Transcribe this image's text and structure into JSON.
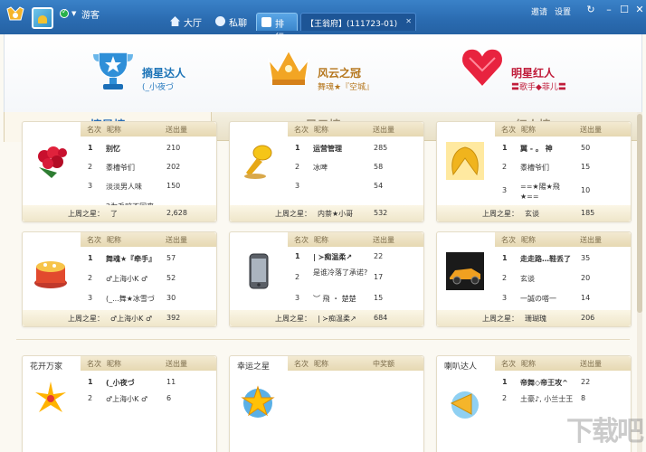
{
  "window": {
    "username": "游客",
    "nav": {
      "hall": "大厅",
      "chat": "私聊",
      "rank": "排行",
      "room": "【王翁府】(111723-01)"
    },
    "links": {
      "invite": "邀请",
      "settings": "设置"
    }
  },
  "stars": [
    {
      "title": "摘星达人",
      "who": "(_小夜づ",
      "icon": "trophy-icon"
    },
    {
      "title": "风云之冠",
      "who": "舞魂★『空城』",
      "icon": "crown-icon"
    },
    {
      "title": "明星红人",
      "who": "〓歌手◆菲儿〓",
      "icon": "heart-icon"
    }
  ],
  "rank_tabs": [
    "摘星榜",
    "风云榜",
    "红人榜"
  ],
  "columns": {
    "rank": "名次",
    "nick": "昵称",
    "amount": "送出量",
    "win": "中奖额"
  },
  "cards": [
    {
      "gift": "roses-icon",
      "rows": [
        [
          "1",
          "别忆",
          "210"
        ],
        [
          "2",
          "黍槽爷们",
          "202"
        ],
        [
          "3",
          "淡淡男人味",
          "150"
        ],
        [
          "",
          "2为毛咬不回来",
          ""
        ]
      ],
      "last_label": "上周之星：",
      "last_name": "了",
      "last_value": "2,628"
    },
    {
      "gift": "golden-microphone-icon",
      "rows": [
        [
          "1",
          "运营管理",
          "285"
        ],
        [
          "2",
          "冰啤",
          "58"
        ],
        [
          "3",
          "",
          "54"
        ]
      ],
      "last_label": "上周之星：",
      "last_name": "内萘★小哥",
      "last_value": "532"
    },
    {
      "gift": "gold-wings-icon",
      "rows": [
        [
          "1",
          "翼 -  。 神",
          "50"
        ],
        [
          "2",
          "黍槽爷们",
          "15"
        ],
        [
          "3",
          "==★陽★飛★==",
          "10"
        ]
      ],
      "last_label": "上周之星：",
      "last_name": "玄谈",
      "last_value": "185"
    },
    {
      "gift": "birthday-cake-icon",
      "rows": [
        [
          "1",
          "舞魂★『牵手』",
          "57"
        ],
        [
          "2",
          "♂上海小K ♂",
          "52"
        ],
        [
          "3",
          "(_...舞★冰雪づ",
          "30"
        ]
      ],
      "last_label": "上周之星：",
      "last_name": "♂上海小K ♂",
      "last_value": "392"
    },
    {
      "gift": "iphone-icon",
      "rows": [
        [
          "1",
          "| ≻痴温柔↗",
          "22"
        ],
        [
          "2",
          "是谁冷落了承诺?",
          "17"
        ],
        [
          "3",
          "︶ 飛 ・ 楚楚",
          "15"
        ]
      ],
      "last_label": "上周之星：",
      "last_name": "| ≻痴温柔↗",
      "last_value": "684"
    },
    {
      "gift": "sports-car-icon",
      "rows": [
        [
          "1",
          "走走路…鞋丢了",
          "35"
        ],
        [
          "2",
          "玄谈",
          "20"
        ],
        [
          "3",
          "一誠の嗒一",
          "14"
        ]
      ],
      "last_label": "上周之星：",
      "last_name": "珊瑚瑰",
      "last_value": "206"
    },
    {
      "title": "花开万家",
      "gift": "fireworks-icon",
      "rows": [
        [
          "1",
          "(_小夜づ",
          "11"
        ],
        [
          "2",
          "♂上海小K ♂",
          "6"
        ]
      ]
    },
    {
      "title": "幸运之星",
      "gift": "lucky-star-icon",
      "rows": []
    },
    {
      "title": "喇叭达人",
      "gift": "trumpet-icon",
      "rows": [
        [
          "1",
          "帝舞◇帝王攻^",
          "22"
        ],
        [
          "2",
          "土豪♪, 小兰士王",
          "8"
        ]
      ]
    }
  ],
  "watermark": "下载吧",
  "colors": {
    "titlebar": "#2a6bb0",
    "accent_blue": "#2a6eb4",
    "accent_red": "#c01c3a"
  }
}
